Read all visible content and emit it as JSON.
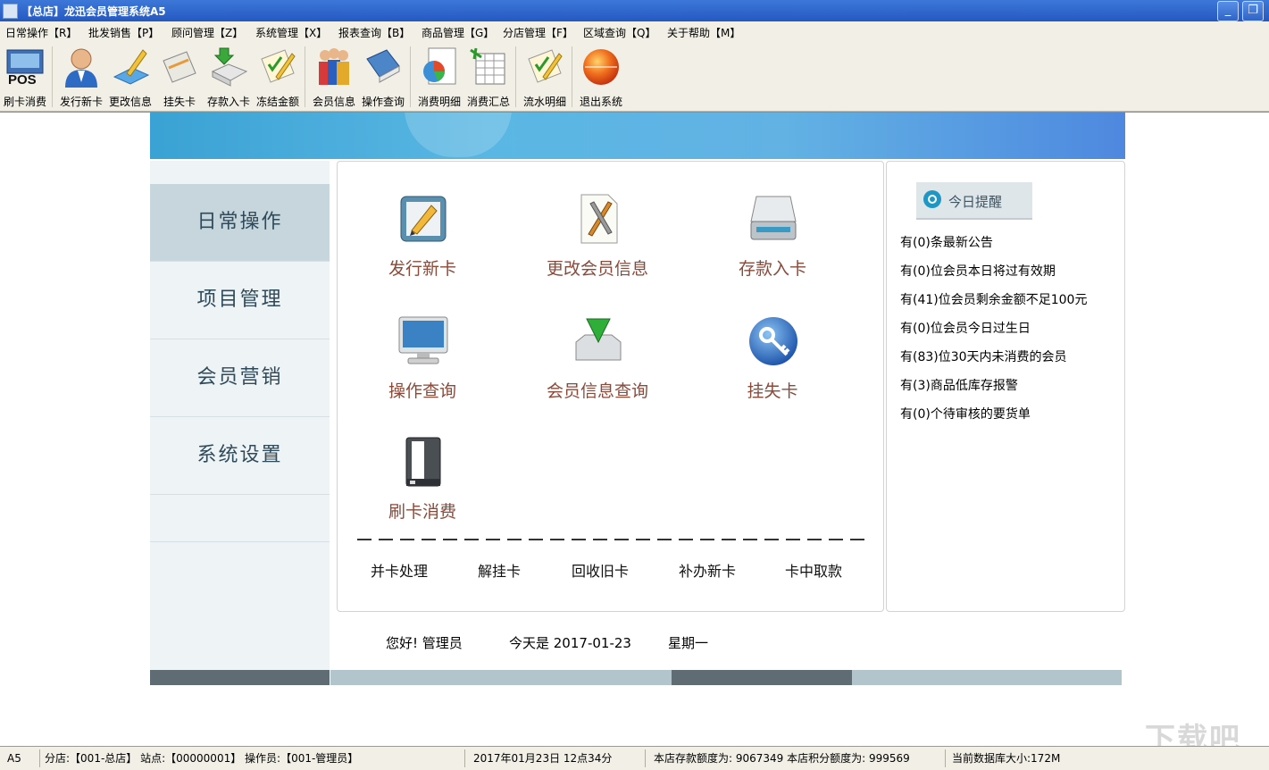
{
  "window": {
    "title": "【总店】龙迅会员管理系统A5",
    "minimize": "_",
    "restore": "❐"
  },
  "menu": [
    "日常操作【R】",
    "批发销售【P】",
    "顾问管理【Z】",
    "系统管理【X】",
    "报表查询【B】",
    "商品管理【G】",
    "分店管理【F】",
    "区域查询【Q】",
    "关于帮助【M】"
  ],
  "toolbar": [
    {
      "label": "刷卡消费",
      "icon": "pos-terminal-icon"
    },
    {
      "label": "发行新卡",
      "icon": "user-icon"
    },
    {
      "label": "更改信息",
      "icon": "edit-pencil-icon"
    },
    {
      "label": "挂失卡",
      "icon": "card-icon"
    },
    {
      "label": "存款入卡",
      "icon": "deposit-arrow-icon"
    },
    {
      "label": "冻结金额",
      "icon": "checklist-icon"
    },
    {
      "label": "会员信息",
      "icon": "members-icon"
    },
    {
      "label": "操作查询",
      "icon": "book-icon"
    },
    {
      "label": "消费明细",
      "icon": "pie-report-icon"
    },
    {
      "label": "消费汇总",
      "icon": "spreadsheet-icon"
    },
    {
      "label": "流水明细",
      "icon": "checklist-icon"
    },
    {
      "label": "退出系统",
      "icon": "exit-ball-icon"
    }
  ],
  "nav": [
    {
      "label": "日常操作",
      "active": true
    },
    {
      "label": "项目管理",
      "active": false
    },
    {
      "label": "会员营销",
      "active": false
    },
    {
      "label": "系统设置",
      "active": false
    }
  ],
  "functions": [
    {
      "label": "发行新卡",
      "icon": "issue-card-icon"
    },
    {
      "label": "更改会员信息",
      "icon": "edit-info-icon"
    },
    {
      "label": "存款入卡",
      "icon": "scanner-icon"
    },
    {
      "label": "操作查询",
      "icon": "monitor-icon"
    },
    {
      "label": "会员信息查询",
      "icon": "download-tray-icon"
    },
    {
      "label": "挂失卡",
      "icon": "key-icon"
    },
    {
      "label": "刷卡消费",
      "icon": "card-terminal-icon"
    }
  ],
  "subfunctions": [
    "并卡处理",
    "解挂卡",
    "回收旧卡",
    "补办新卡",
    "卡中取款"
  ],
  "reminders": {
    "title": "今日提醒",
    "items": [
      "有(0)条最新公告",
      "有(0)位会员本日将过有效期",
      "有(41)位会员剩余金额不足100元",
      "有(0)位会员今日过生日",
      "有(83)位30天内未消费的会员",
      "有(3)商品低库存报警",
      "有(0)个待审核的要货单"
    ]
  },
  "greeting": {
    "hello": "您好! 管理员",
    "today": "今天是 2017-01-23",
    "weekday": "星期一"
  },
  "status": {
    "version": "A5",
    "branch": "分店:【001-总店】 站点:【00000001】  操作员:【001-管理员】",
    "datetime": "2017年01月23日 12点34分",
    "quota": "本店存款额度为: 9067349 本店积分额度为: 999569",
    "dbsize": "当前数据库大小:172M"
  },
  "watermark": "下载吧"
}
